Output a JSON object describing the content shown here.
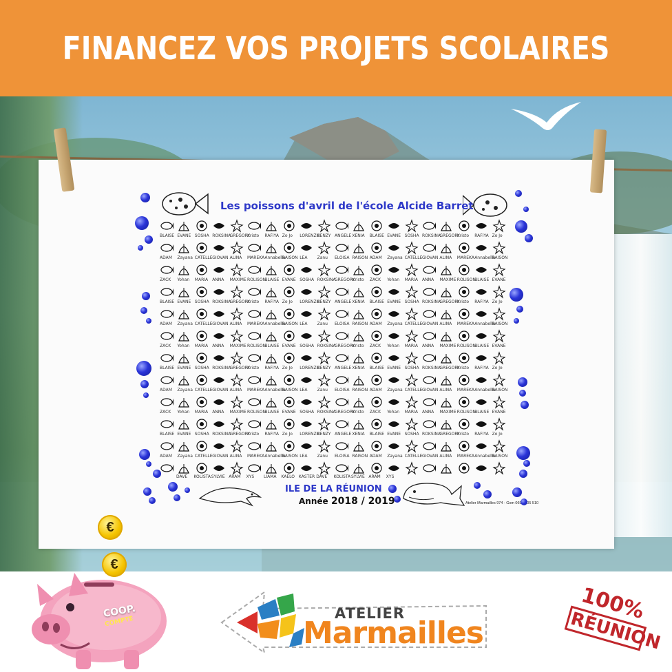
{
  "banner": {
    "title": "FINANCEZ VOS PROJETS SCOLAIRES",
    "color": "#ef9338"
  },
  "towel": {
    "title": "Les poissons d'avril de l'école Alcide Barret",
    "island": "ILE DE LA RÉUNION",
    "year_prefix": "Année",
    "year": "2018 / 2019",
    "credit": "Atelier Marmailles 974 - Gsm 0693 205 510",
    "accent_color": "#2d38c8",
    "names_rows": [
      [
        "BLAISE",
        "EVANE",
        "SOSHA",
        "ROKSINA",
        "GREGORY",
        "Kristo",
        "RAFIYA",
        "Zo Jo",
        "LORENZO",
        "KENZY",
        "ANGELE",
        "XENIA",
        "BLAISE",
        "EVANE",
        "SOSHA",
        "ROKSINA",
        "GREGORY",
        "Kristo",
        "RAFIYA",
        "Zo Jo"
      ],
      [
        "ADAM",
        "Zayana",
        "CATELLE",
        "GIOVAN",
        "ALINA",
        "MAREKA",
        "Annabella",
        "RAISON",
        "LEA",
        "Zanu",
        "ELOISA",
        "RAISON",
        "ADAM",
        "Zayana",
        "CATELLE",
        "GIOVAN",
        "ALINA",
        "MAREKA",
        "Annabella",
        "RAISON"
      ],
      [
        "ZACK",
        "Yohan",
        "MARIA",
        "ANNA",
        "MAXIME",
        "ROLISON",
        "BLAISE",
        "EVANE",
        "SOSHA",
        "ROKSINA",
        "GREGORY",
        "Kristo",
        "ZACK",
        "Yohan",
        "MARIA",
        "ANNA",
        "MAXIME",
        "ROLISON",
        "BLAISE",
        "EVANE"
      ],
      [
        "DAVE",
        "KOLISTA",
        "SYLVIE",
        "ARAM",
        "XYS",
        "LIAMA",
        "KAELO",
        "KASTER",
        "DAVE",
        "KOLISTA",
        "SYLVIE",
        "ARAM",
        "XYS"
      ]
    ]
  },
  "footer": {
    "coin_symbol": "€",
    "coop_label": "COOP.",
    "compte_label": "COMPTE",
    "logo_line1": "ATELIER",
    "logo_line2": "Marmailles",
    "stamp_percent": "100%",
    "stamp_word": "RÉUNION"
  },
  "icons": [
    "fish-icon",
    "whale-icon",
    "dolphin-icon",
    "shell-icon",
    "bubble-icon",
    "piggy-bank-icon",
    "coin-icon",
    "bird-icon",
    "clothespin-icon"
  ]
}
